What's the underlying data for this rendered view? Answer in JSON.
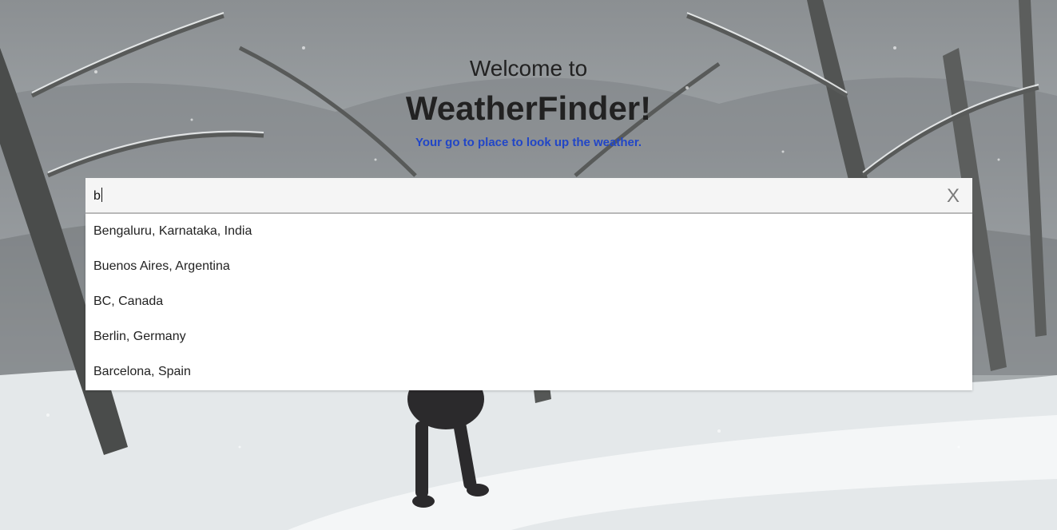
{
  "hero": {
    "welcome": "Welcome to",
    "brand": "WeatherFinder!",
    "tagline": "Your go to place to look up the weather."
  },
  "search": {
    "value": "b",
    "clear_label": "X"
  },
  "suggestions": [
    "Bengaluru, Karnataka, India",
    "Buenos Aires, Argentina",
    "BC, Canada",
    "Berlin, Germany",
    "Barcelona, Spain"
  ],
  "colors": {
    "tagline": "#2146c7",
    "heading": "#222222",
    "search_bg": "#f5f5f5",
    "dropdown_bg": "#ffffff"
  }
}
